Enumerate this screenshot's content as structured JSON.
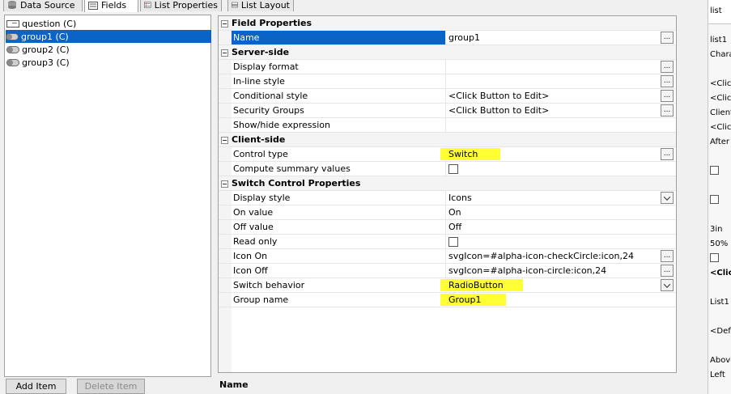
{
  "tabs": [
    {
      "label": "Data Source",
      "icon": "database-icon"
    },
    {
      "label": "Fields",
      "icon": "fields-icon"
    },
    {
      "label": "List Properties",
      "icon": "properties-icon"
    },
    {
      "label": "List Layout",
      "icon": "layout-icon"
    }
  ],
  "tree": {
    "items": [
      {
        "label": "question (C)",
        "icon": "field-icon"
      },
      {
        "label": "group1 (C)",
        "icon": "toggle-icon",
        "selected": true
      },
      {
        "label": "group2 (C)",
        "icon": "toggle-icon"
      },
      {
        "label": "group3 (C)",
        "icon": "toggle-icon"
      }
    ],
    "add_label": "Add Item",
    "delete_label": "Delete Item"
  },
  "properties": {
    "field_properties": "Field Properties",
    "name_label": "Name",
    "name_value": "group1",
    "server_side": "Server-side",
    "display_format": "Display format",
    "inline_style": "In-line style",
    "conditional_style": "Conditional style",
    "conditional_style_value": "<Click Button to Edit>",
    "security_groups": "Security Groups",
    "security_groups_value": "<Click Button to Edit>",
    "show_hide": "Show/hide expression",
    "client_side": "Client-side",
    "control_type": "Control type",
    "control_type_value": "Switch",
    "compute_summary": "Compute summary values",
    "switch_props": "Switch Control Properties",
    "display_style": "Display style",
    "display_style_value": "Icons",
    "on_value": "On value",
    "on_value_value": "On",
    "off_value": "Off value",
    "off_value_value": "Off",
    "read_only": "Read only",
    "icon_on": "Icon On",
    "icon_on_value": "svgIcon=#alpha-icon-checkCircle:icon,24",
    "icon_off": "Icon Off",
    "icon_off_value": "svgIcon=#alpha-icon-circle:icon,24",
    "switch_behavior": "Switch behavior",
    "switch_behavior_value": "RadioButton",
    "group_name": "Group name",
    "group_name_value": "Group1",
    "ellipsis": "..."
  },
  "description_title": "Name",
  "right_panel": {
    "items": [
      "list",
      "list1",
      "Chara",
      "<Click",
      "<Click",
      "Client",
      "<Click",
      "After",
      "3in",
      "50%",
      "<Clic",
      "List1",
      "<Defa",
      "Above",
      "Left"
    ]
  },
  "colors": {
    "selection": "#0a64c8",
    "highlight": "#ffff33"
  }
}
